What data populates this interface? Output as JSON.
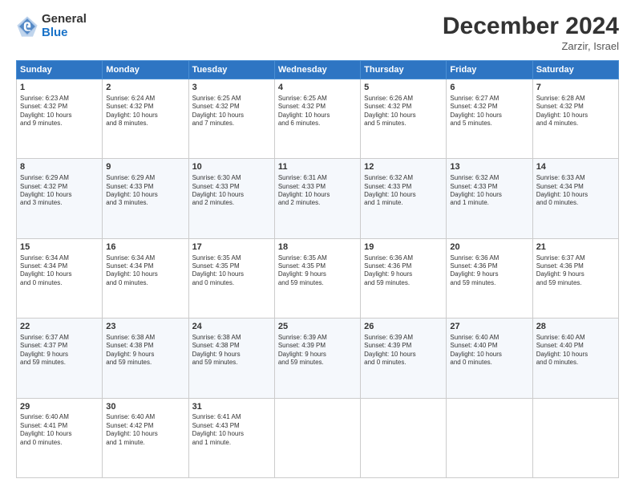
{
  "header": {
    "logo_general": "General",
    "logo_blue": "Blue",
    "title": "December 2024",
    "location": "Zarzir, Israel"
  },
  "days_of_week": [
    "Sunday",
    "Monday",
    "Tuesday",
    "Wednesday",
    "Thursday",
    "Friday",
    "Saturday"
  ],
  "weeks": [
    [
      {
        "day": 1,
        "lines": [
          "Sunrise: 6:23 AM",
          "Sunset: 4:32 PM",
          "Daylight: 10 hours",
          "and 9 minutes."
        ]
      },
      {
        "day": 2,
        "lines": [
          "Sunrise: 6:24 AM",
          "Sunset: 4:32 PM",
          "Daylight: 10 hours",
          "and 8 minutes."
        ]
      },
      {
        "day": 3,
        "lines": [
          "Sunrise: 6:25 AM",
          "Sunset: 4:32 PM",
          "Daylight: 10 hours",
          "and 7 minutes."
        ]
      },
      {
        "day": 4,
        "lines": [
          "Sunrise: 6:25 AM",
          "Sunset: 4:32 PM",
          "Daylight: 10 hours",
          "and 6 minutes."
        ]
      },
      {
        "day": 5,
        "lines": [
          "Sunrise: 6:26 AM",
          "Sunset: 4:32 PM",
          "Daylight: 10 hours",
          "and 5 minutes."
        ]
      },
      {
        "day": 6,
        "lines": [
          "Sunrise: 6:27 AM",
          "Sunset: 4:32 PM",
          "Daylight: 10 hours",
          "and 5 minutes."
        ]
      },
      {
        "day": 7,
        "lines": [
          "Sunrise: 6:28 AM",
          "Sunset: 4:32 PM",
          "Daylight: 10 hours",
          "and 4 minutes."
        ]
      }
    ],
    [
      {
        "day": 8,
        "lines": [
          "Sunrise: 6:29 AM",
          "Sunset: 4:32 PM",
          "Daylight: 10 hours",
          "and 3 minutes."
        ]
      },
      {
        "day": 9,
        "lines": [
          "Sunrise: 6:29 AM",
          "Sunset: 4:33 PM",
          "Daylight: 10 hours",
          "and 3 minutes."
        ]
      },
      {
        "day": 10,
        "lines": [
          "Sunrise: 6:30 AM",
          "Sunset: 4:33 PM",
          "Daylight: 10 hours",
          "and 2 minutes."
        ]
      },
      {
        "day": 11,
        "lines": [
          "Sunrise: 6:31 AM",
          "Sunset: 4:33 PM",
          "Daylight: 10 hours",
          "and 2 minutes."
        ]
      },
      {
        "day": 12,
        "lines": [
          "Sunrise: 6:32 AM",
          "Sunset: 4:33 PM",
          "Daylight: 10 hours",
          "and 1 minute."
        ]
      },
      {
        "day": 13,
        "lines": [
          "Sunrise: 6:32 AM",
          "Sunset: 4:33 PM",
          "Daylight: 10 hours",
          "and 1 minute."
        ]
      },
      {
        "day": 14,
        "lines": [
          "Sunrise: 6:33 AM",
          "Sunset: 4:34 PM",
          "Daylight: 10 hours",
          "and 0 minutes."
        ]
      }
    ],
    [
      {
        "day": 15,
        "lines": [
          "Sunrise: 6:34 AM",
          "Sunset: 4:34 PM",
          "Daylight: 10 hours",
          "and 0 minutes."
        ]
      },
      {
        "day": 16,
        "lines": [
          "Sunrise: 6:34 AM",
          "Sunset: 4:34 PM",
          "Daylight: 10 hours",
          "and 0 minutes."
        ]
      },
      {
        "day": 17,
        "lines": [
          "Sunrise: 6:35 AM",
          "Sunset: 4:35 PM",
          "Daylight: 10 hours",
          "and 0 minutes."
        ]
      },
      {
        "day": 18,
        "lines": [
          "Sunrise: 6:35 AM",
          "Sunset: 4:35 PM",
          "Daylight: 9 hours",
          "and 59 minutes."
        ]
      },
      {
        "day": 19,
        "lines": [
          "Sunrise: 6:36 AM",
          "Sunset: 4:36 PM",
          "Daylight: 9 hours",
          "and 59 minutes."
        ]
      },
      {
        "day": 20,
        "lines": [
          "Sunrise: 6:36 AM",
          "Sunset: 4:36 PM",
          "Daylight: 9 hours",
          "and 59 minutes."
        ]
      },
      {
        "day": 21,
        "lines": [
          "Sunrise: 6:37 AM",
          "Sunset: 4:36 PM",
          "Daylight: 9 hours",
          "and 59 minutes."
        ]
      }
    ],
    [
      {
        "day": 22,
        "lines": [
          "Sunrise: 6:37 AM",
          "Sunset: 4:37 PM",
          "Daylight: 9 hours",
          "and 59 minutes."
        ]
      },
      {
        "day": 23,
        "lines": [
          "Sunrise: 6:38 AM",
          "Sunset: 4:38 PM",
          "Daylight: 9 hours",
          "and 59 minutes."
        ]
      },
      {
        "day": 24,
        "lines": [
          "Sunrise: 6:38 AM",
          "Sunset: 4:38 PM",
          "Daylight: 9 hours",
          "and 59 minutes."
        ]
      },
      {
        "day": 25,
        "lines": [
          "Sunrise: 6:39 AM",
          "Sunset: 4:39 PM",
          "Daylight: 9 hours",
          "and 59 minutes."
        ]
      },
      {
        "day": 26,
        "lines": [
          "Sunrise: 6:39 AM",
          "Sunset: 4:39 PM",
          "Daylight: 10 hours",
          "and 0 minutes."
        ]
      },
      {
        "day": 27,
        "lines": [
          "Sunrise: 6:40 AM",
          "Sunset: 4:40 PM",
          "Daylight: 10 hours",
          "and 0 minutes."
        ]
      },
      {
        "day": 28,
        "lines": [
          "Sunrise: 6:40 AM",
          "Sunset: 4:40 PM",
          "Daylight: 10 hours",
          "and 0 minutes."
        ]
      }
    ],
    [
      {
        "day": 29,
        "lines": [
          "Sunrise: 6:40 AM",
          "Sunset: 4:41 PM",
          "Daylight: 10 hours",
          "and 0 minutes."
        ]
      },
      {
        "day": 30,
        "lines": [
          "Sunrise: 6:40 AM",
          "Sunset: 4:42 PM",
          "Daylight: 10 hours",
          "and 1 minute."
        ]
      },
      {
        "day": 31,
        "lines": [
          "Sunrise: 6:41 AM",
          "Sunset: 4:43 PM",
          "Daylight: 10 hours",
          "and 1 minute."
        ]
      },
      null,
      null,
      null,
      null
    ]
  ]
}
